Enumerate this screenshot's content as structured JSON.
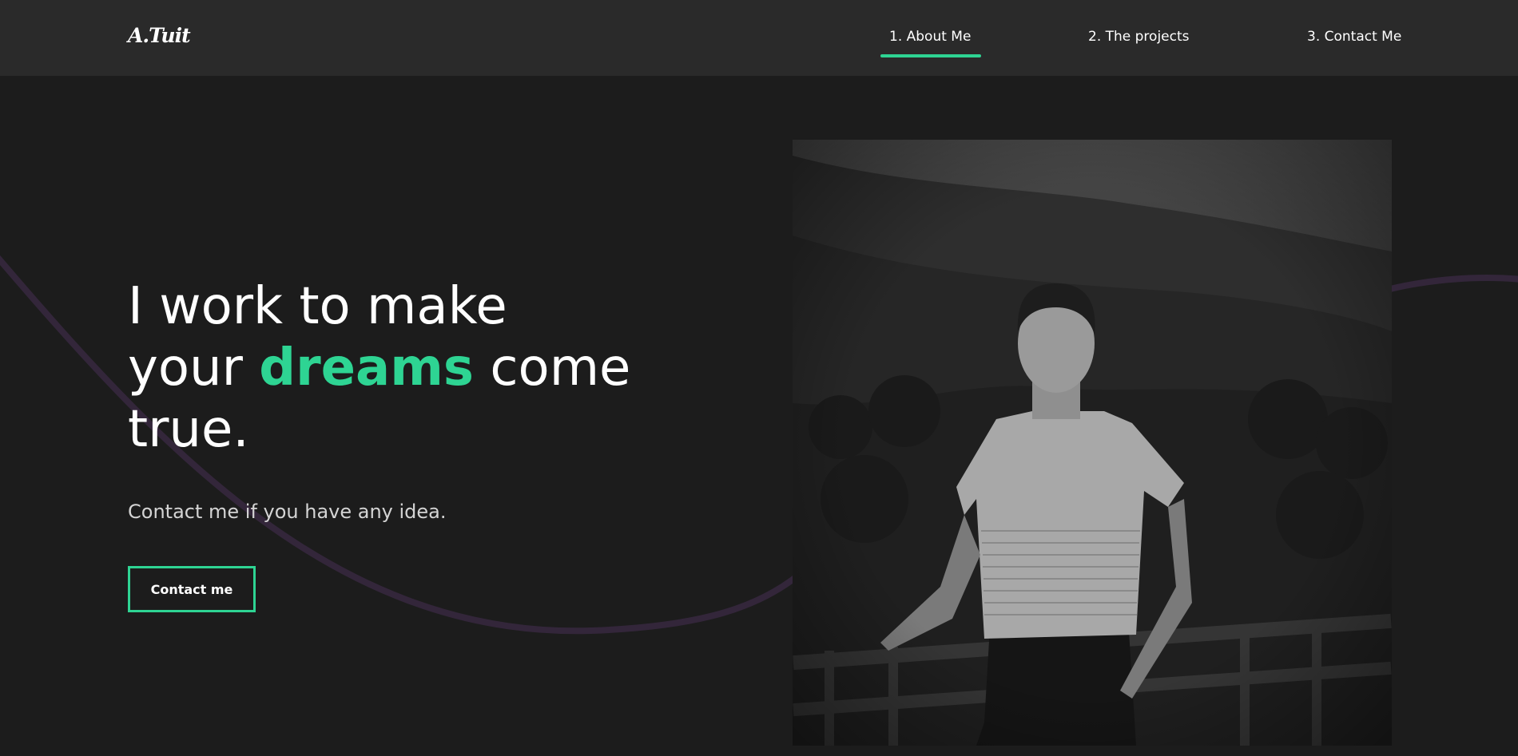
{
  "header": {
    "logo": "A.Tuit",
    "nav": [
      {
        "label": "1. About Me",
        "active": true
      },
      {
        "label": "2. The projects",
        "active": false
      },
      {
        "label": "3. Contact Me",
        "active": false
      }
    ]
  },
  "hero": {
    "title_line1": "I work to make",
    "title_line2_before": "your ",
    "title_highlight": "dreams",
    "title_line2_after": " come",
    "title_line3": "true.",
    "subtitle": "Contact me if you have any idea.",
    "cta_label": "Contact me",
    "photo_icon": "portrait-photo-icon"
  },
  "colors": {
    "background": "#1c1c1c",
    "navbar": "#2a2a2a",
    "accent": "#2ed493",
    "curve": "#33263a",
    "subtitle": "#d4d4d4"
  }
}
